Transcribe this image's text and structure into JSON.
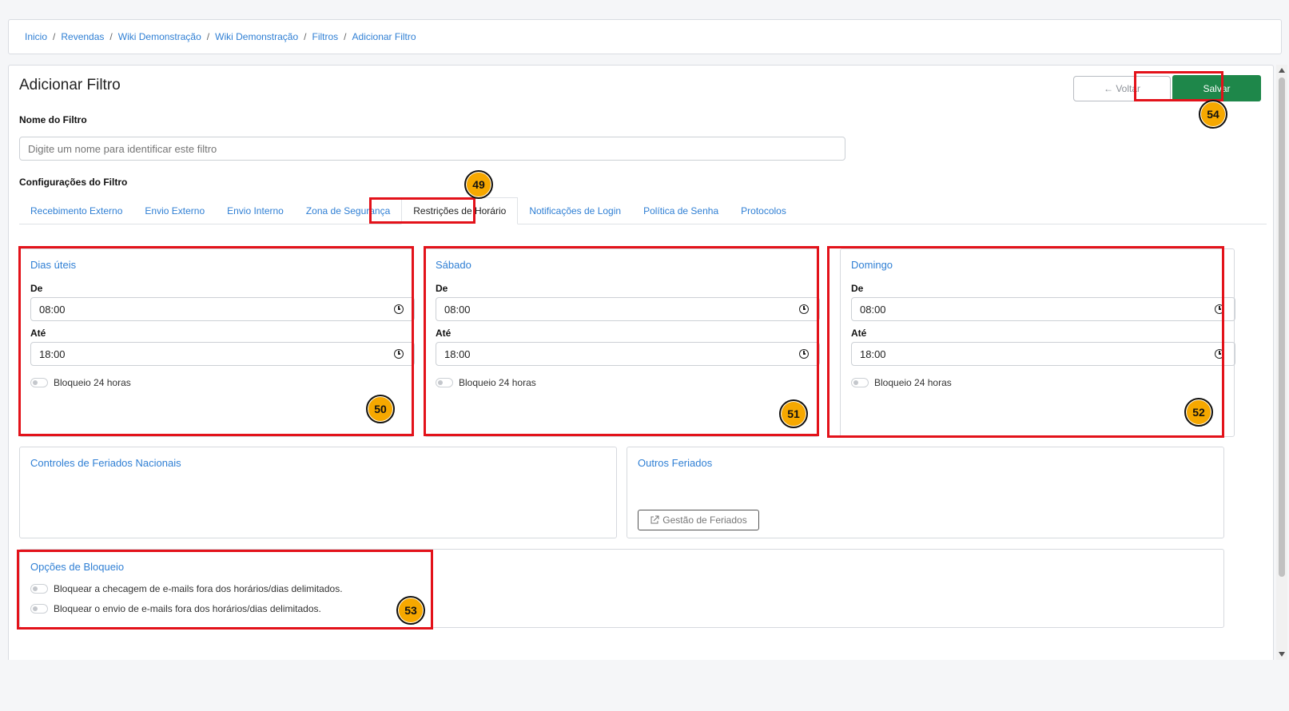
{
  "breadcrumb": [
    "Inicio",
    "Revendas",
    "Wiki Demonstração",
    "Wiki Demonstração",
    "Filtros",
    "Adicionar Filtro"
  ],
  "page": {
    "title": "Adicionar Filtro"
  },
  "toolbar": {
    "back_label": "← Voltar",
    "save_label": "Salvar"
  },
  "form": {
    "name_label": "Nome do Filtro",
    "name_placeholder": "Digite um nome para identificar este filtro",
    "config_label": "Configurações do Filtro"
  },
  "tabs": [
    {
      "label": "Recebimento Externo"
    },
    {
      "label": "Envio Externo"
    },
    {
      "label": "Envio Interno"
    },
    {
      "label": "Zona de Segurança"
    },
    {
      "label": "Restrições de Horário",
      "active": true
    },
    {
      "label": "Notificações de Login"
    },
    {
      "label": "Política de Senha"
    },
    {
      "label": "Protocolos"
    }
  ],
  "schedules": [
    {
      "title": "Dias úteis",
      "from_label": "De",
      "from": "08:00",
      "to_label": "Até",
      "to": "18:00",
      "block_label": "Bloqueio 24 horas"
    },
    {
      "title": "Sábado",
      "from_label": "De",
      "from": "08:00",
      "to_label": "Até",
      "to": "18:00",
      "block_label": "Bloqueio 24 horas"
    },
    {
      "title": "Domingo",
      "from_label": "De",
      "from": "08:00",
      "to_label": "Até",
      "to": "18:00",
      "block_label": "Bloqueio 24 horas"
    }
  ],
  "holidays": {
    "national_title": "Controles de Feriados Nacionais",
    "other_title": "Outros Feriados",
    "manage_label": "Gestão de Feriados"
  },
  "block_options": {
    "title": "Opções de Bloqueio",
    "check_label": "Bloquear a checagem de e-mails fora dos horários/dias delimitados.",
    "send_label": "Bloquear o envio de e-mails fora dos horários/dias delimitados."
  },
  "annotations": [
    "49",
    "50",
    "51",
    "52",
    "53",
    "54"
  ],
  "colors": {
    "accent": "#2f7fd4",
    "save": "#1e874a",
    "highlight": "#e3121a",
    "badge": "#f6a800"
  }
}
